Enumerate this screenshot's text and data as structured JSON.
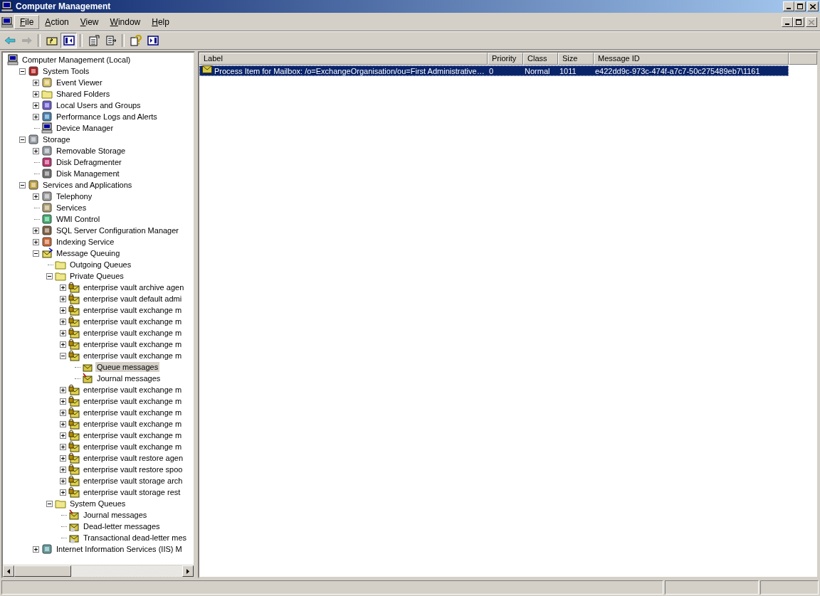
{
  "window": {
    "title": "Computer Management"
  },
  "menu": [
    {
      "label": "File",
      "selected": true
    },
    {
      "label": "Action",
      "selected": false
    },
    {
      "label": "View",
      "selected": false
    },
    {
      "label": "Window",
      "selected": false
    },
    {
      "label": "Help",
      "selected": false
    }
  ],
  "mdi_controls": {
    "close_disabled": true
  },
  "toolbar": [
    {
      "kind": "back",
      "disabled": false,
      "pressed": false
    },
    {
      "kind": "forward",
      "disabled": true,
      "pressed": false
    },
    {
      "kind": "sep"
    },
    {
      "kind": "up",
      "disabled": false,
      "pressed": false
    },
    {
      "kind": "tree",
      "disabled": false,
      "pressed": true
    },
    {
      "kind": "sep"
    },
    {
      "kind": "properties",
      "disabled": false,
      "pressed": false
    },
    {
      "kind": "export",
      "disabled": false,
      "pressed": false
    },
    {
      "kind": "sep"
    },
    {
      "kind": "help",
      "disabled": false,
      "pressed": false
    },
    {
      "kind": "pane",
      "disabled": false,
      "pressed": false
    }
  ],
  "tree": [
    {
      "label": "Computer Management (Local)",
      "kind": "computer",
      "selected": false,
      "children": [
        {
          "label": "System Tools",
          "kind": "tools",
          "expanded": true,
          "selected": false,
          "children": [
            {
              "label": "Event Viewer",
              "kind": "log",
              "expanded": false,
              "selected": false
            },
            {
              "label": "Shared Folders",
              "kind": "folder",
              "expanded": false,
              "selected": false
            },
            {
              "label": "Local Users and Groups",
              "kind": "users",
              "expanded": false,
              "selected": false
            },
            {
              "label": "Performance Logs and Alerts",
              "kind": "perf",
              "expanded": false,
              "selected": false
            },
            {
              "label": "Device Manager",
              "kind": "computer",
              "selected": false
            }
          ]
        },
        {
          "label": "Storage",
          "kind": "storage",
          "expanded": true,
          "selected": false,
          "children": [
            {
              "label": "Removable Storage",
              "kind": "storage",
              "expanded": false,
              "selected": false
            },
            {
              "label": "Disk Defragmenter",
              "kind": "defrag",
              "selected": false
            },
            {
              "label": "Disk Management",
              "kind": "disk",
              "selected": false
            }
          ]
        },
        {
          "label": "Services and Applications",
          "kind": "services",
          "expanded": true,
          "selected": false,
          "children": [
            {
              "label": "Telephony",
              "kind": "phone",
              "expanded": false,
              "selected": false
            },
            {
              "label": "Services",
              "kind": "gears",
              "selected": false
            },
            {
              "label": "WMI Control",
              "kind": "wmi",
              "selected": false
            },
            {
              "label": "SQL Server Configuration Manager",
              "kind": "sql",
              "expanded": false,
              "selected": false
            },
            {
              "label": "Indexing Service",
              "kind": "index",
              "expanded": false,
              "selected": false
            },
            {
              "label": "Message Queuing",
              "kind": "msmq",
              "expanded": true,
              "selected": false,
              "children": [
                {
                  "label": "Outgoing Queues",
                  "kind": "folder",
                  "selected": false
                },
                {
                  "label": "Private Queues",
                  "kind": "folder",
                  "expanded": true,
                  "selected": false,
                  "children": [
                    {
                      "label": "enterprise vault archive agen",
                      "kind": "queue",
                      "expanded": false,
                      "selected": false
                    },
                    {
                      "label": "enterprise vault default admi",
                      "kind": "queue",
                      "expanded": false,
                      "selected": false
                    },
                    {
                      "label": "enterprise vault exchange m",
                      "kind": "queue",
                      "expanded": false,
                      "selected": false
                    },
                    {
                      "label": "enterprise vault exchange m",
                      "kind": "queue",
                      "expanded": false,
                      "selected": false
                    },
                    {
                      "label": "enterprise vault exchange m",
                      "kind": "queue",
                      "expanded": false,
                      "selected": false
                    },
                    {
                      "label": "enterprise vault exchange m",
                      "kind": "queue",
                      "expanded": false,
                      "selected": false
                    },
                    {
                      "label": "enterprise vault exchange m",
                      "kind": "queue",
                      "expanded": true,
                      "selected": false,
                      "children": [
                        {
                          "label": "Queue messages",
                          "kind": "messages",
                          "selected": true
                        },
                        {
                          "label": "Journal messages",
                          "kind": "journal",
                          "selected": false
                        }
                      ]
                    },
                    {
                      "label": "enterprise vault exchange m",
                      "kind": "queue",
                      "expanded": false,
                      "selected": false
                    },
                    {
                      "label": "enterprise vault exchange m",
                      "kind": "queue",
                      "expanded": false,
                      "selected": false
                    },
                    {
                      "label": "enterprise vault exchange m",
                      "kind": "queue",
                      "expanded": false,
                      "selected": false
                    },
                    {
                      "label": "enterprise vault exchange m",
                      "kind": "queue",
                      "expanded": false,
                      "selected": false
                    },
                    {
                      "label": "enterprise vault exchange m",
                      "kind": "queue",
                      "expanded": false,
                      "selected": false
                    },
                    {
                      "label": "enterprise vault exchange m",
                      "kind": "queue",
                      "expanded": false,
                      "selected": false
                    },
                    {
                      "label": "enterprise vault restore agen",
                      "kind": "queue",
                      "expanded": false,
                      "selected": false
                    },
                    {
                      "label": "enterprise vault restore spoo",
                      "kind": "queue",
                      "expanded": false,
                      "selected": false
                    },
                    {
                      "label": "enterprise vault storage arch",
                      "kind": "queue",
                      "expanded": false,
                      "selected": false
                    },
                    {
                      "label": "enterprise vault storage rest",
                      "kind": "queue",
                      "expanded": false,
                      "selected": false
                    }
                  ]
                },
                {
                  "label": "System Queues",
                  "kind": "folder",
                  "expanded": true,
                  "selected": false,
                  "children": [
                    {
                      "label": "Journal messages",
                      "kind": "journal",
                      "selected": false
                    },
                    {
                      "label": "Dead-letter messages",
                      "kind": "deadletter",
                      "selected": false
                    },
                    {
                      "label": "Transactional dead-letter mes",
                      "kind": "deadletter",
                      "selected": false
                    }
                  ]
                }
              ]
            },
            {
              "label": "Internet Information Services (IIS) M",
              "kind": "iis",
              "expanded": false,
              "selected": false
            }
          ]
        }
      ]
    }
  ],
  "table": {
    "columns": [
      "Label",
      "Priority",
      "Class",
      "Size",
      "Message ID"
    ],
    "rows": [
      {
        "selected": true,
        "cells": [
          "Process Item for Mailbox: /o=ExchangeOrganisation/ou=First Administrative…",
          "0",
          "Normal",
          "1011",
          "e422dd9c-973c-474f-a7c7-50c275489eb7\\1161"
        ]
      }
    ]
  }
}
